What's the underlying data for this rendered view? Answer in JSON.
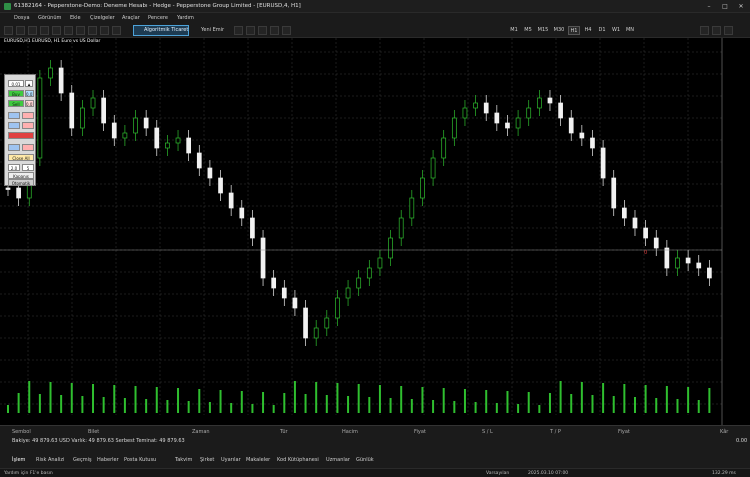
{
  "window": {
    "title": "61382164 - Pepperstone-Demo: Deneme Hesabı - Hedge - Pepperstone Group Limited - [EURUSD,4, H1]"
  },
  "menu": [
    "Dosya",
    "Görünüm",
    "Ekle",
    "Çizelgeler",
    "Araçlar",
    "Pencere",
    "Yardım"
  ],
  "toolbar": {
    "algo_label": "Algoritmik Ticaret",
    "new_order_label": "Yeni Emir",
    "timeframes": [
      "M1",
      "M5",
      "M15",
      "M30",
      "H1",
      "H4",
      "D1",
      "W1",
      "MN"
    ],
    "active_timeframe": "H1"
  },
  "chart": {
    "label": "EURUSD,H1  EURUSD, H1  Euro vs US Dollar",
    "bull_color": "#2fbf2f",
    "bear_color": "#f2f2f2",
    "grid_color": "#3a3a3a",
    "marker_text": "0"
  },
  "panel": {
    "lot": "0.01",
    "buy": "Buy",
    "sell": "Sell",
    "buy_price": "0.01",
    "sell_price": "0.01",
    "close_all": "Close All",
    "value_a": "2.0",
    "value_b": "5",
    "close_label": "Kapanış",
    "bottom_label": "Otomatik"
  },
  "terminal": {
    "columns": [
      "Sembol",
      "Bilet",
      "Zaman",
      "Tür",
      "Hacim",
      "Fiyat",
      "S / L",
      "T / P",
      "Fiyat",
      "Kâr"
    ],
    "balance": "Bakiye: 49 879.63 USD  Varlık: 49 879.63  Serbest Teminat: 49 879.63",
    "profit": "0.00",
    "tabs": [
      "İşlem",
      "Risk Analizi",
      "Geçmiş",
      "Haberler",
      "Posta Kutusu",
      "Takvim",
      "Şirket",
      "Uyarılar",
      "Makaleler",
      "Kod Kütüphanesi",
      "Uzmanlar",
      "Günlük"
    ],
    "active_tab": "İşlem"
  },
  "status": {
    "help": "Yardım için F1'e basın",
    "profile": "Varsayılan",
    "datetime": "2025.03.10 07:00",
    "ping": "132.29 ms"
  }
}
